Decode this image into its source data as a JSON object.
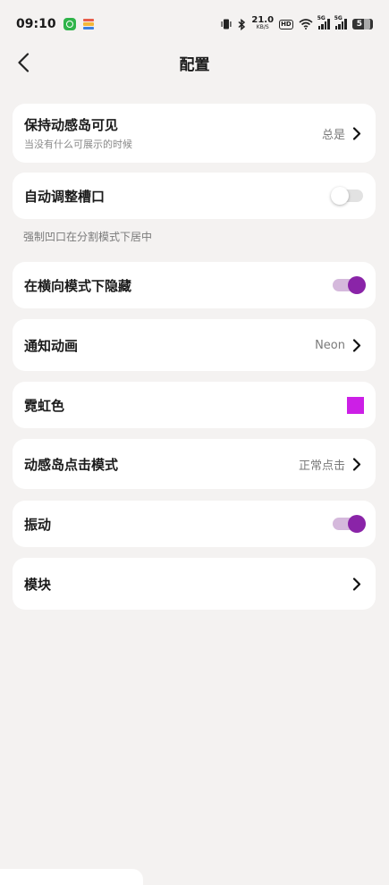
{
  "status_bar": {
    "time": "09:10",
    "net_speed_value": "21.0",
    "net_speed_unit": "KB/S",
    "hd_label": "HD",
    "signal1_label": "5G",
    "signal2_label": "5G",
    "battery_level": "5",
    "icons": [
      "vibrate-icon",
      "bluetooth-icon",
      "wifi-icon"
    ]
  },
  "header": {
    "title": "配置"
  },
  "settings": {
    "keep_island": {
      "label": "保持动感岛可见",
      "sub": "当没有什么可展示的时候",
      "value": "总是"
    },
    "auto_adjust_notch": {
      "label": "自动调整槽口",
      "enabled": false
    },
    "notch_hint": "强制凹口在分割模式下居中",
    "hide_landscape": {
      "label": "在横向模式下隐藏",
      "enabled": true
    },
    "notification_anim": {
      "label": "通知动画",
      "value": "Neon"
    },
    "neon_color": {
      "label": "霓虹色",
      "color": "#cc1fe6"
    },
    "island_click_mode": {
      "label": "动感岛点击模式",
      "value": "正常点击"
    },
    "vibration": {
      "label": "振动",
      "enabled": true
    },
    "modules": {
      "label": "模块"
    }
  },
  "colors": {
    "accent": "#8a24a8",
    "accent_track": "#d5b9dc",
    "background": "#f4f2f1",
    "card": "#ffffff"
  }
}
